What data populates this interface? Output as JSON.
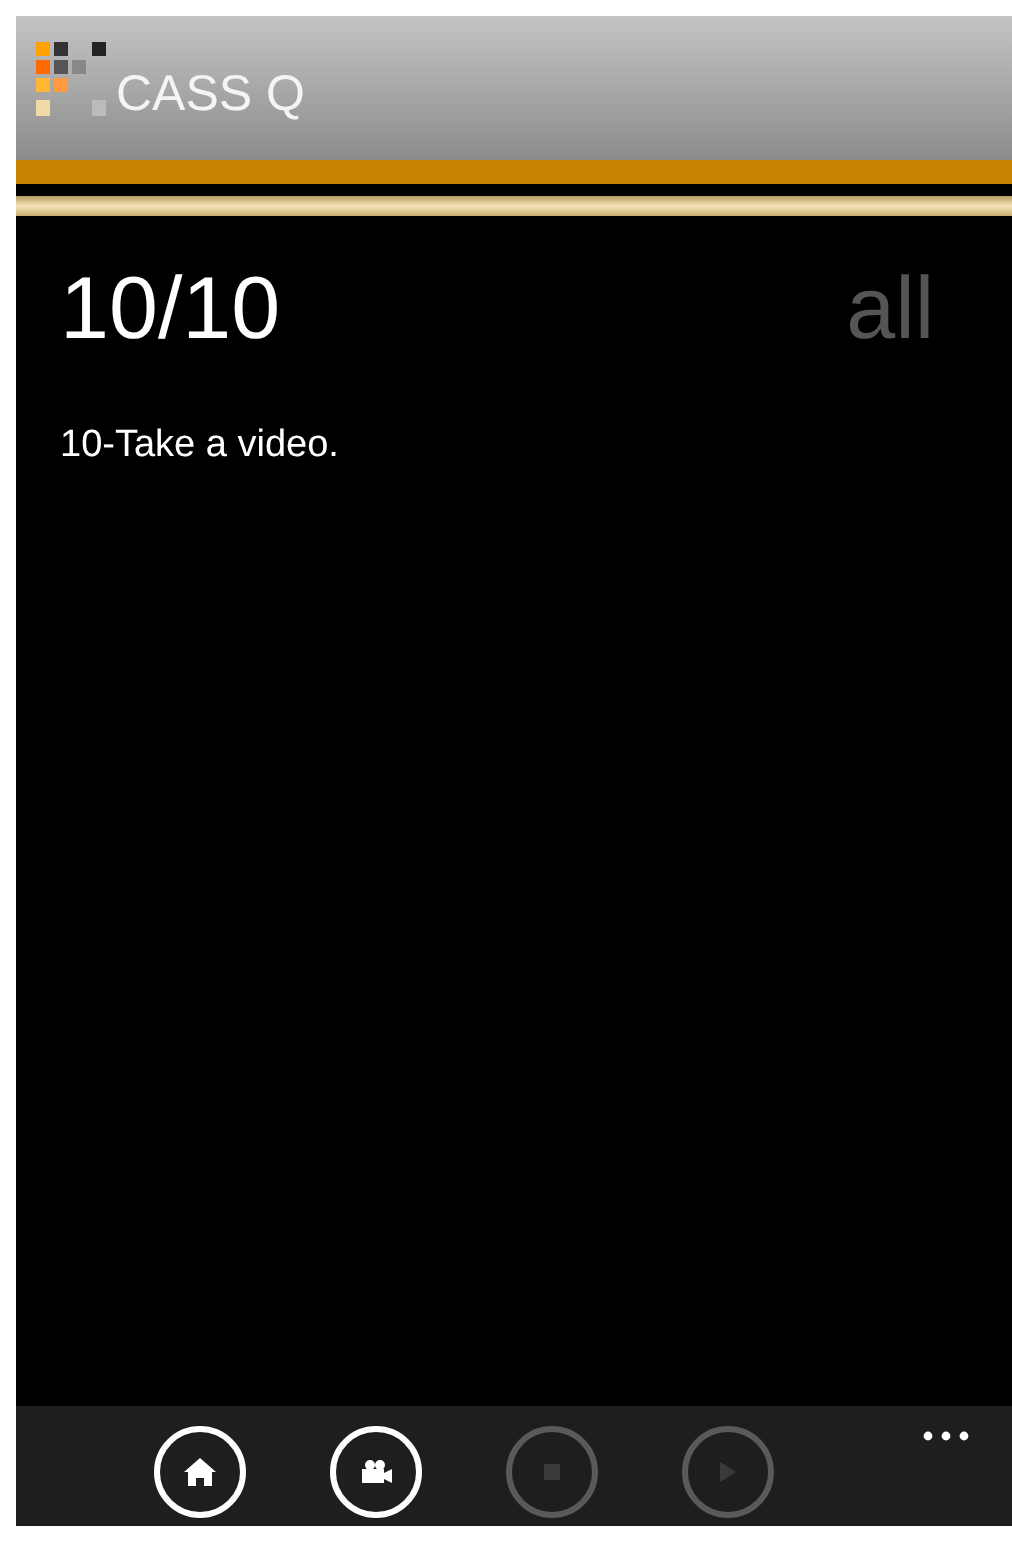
{
  "app": {
    "title": "CASS Q"
  },
  "pivot": [
    {
      "label": "10/10",
      "selected": true
    },
    {
      "label": "all",
      "selected": false
    }
  ],
  "question": {
    "text": "10-Take a video."
  },
  "app_bar": {
    "buttons": [
      {
        "kind": "home",
        "disabled": false
      },
      {
        "kind": "video",
        "disabled": false
      },
      {
        "kind": "stop",
        "disabled": true
      },
      {
        "kind": "play",
        "disabled": true
      }
    ]
  }
}
